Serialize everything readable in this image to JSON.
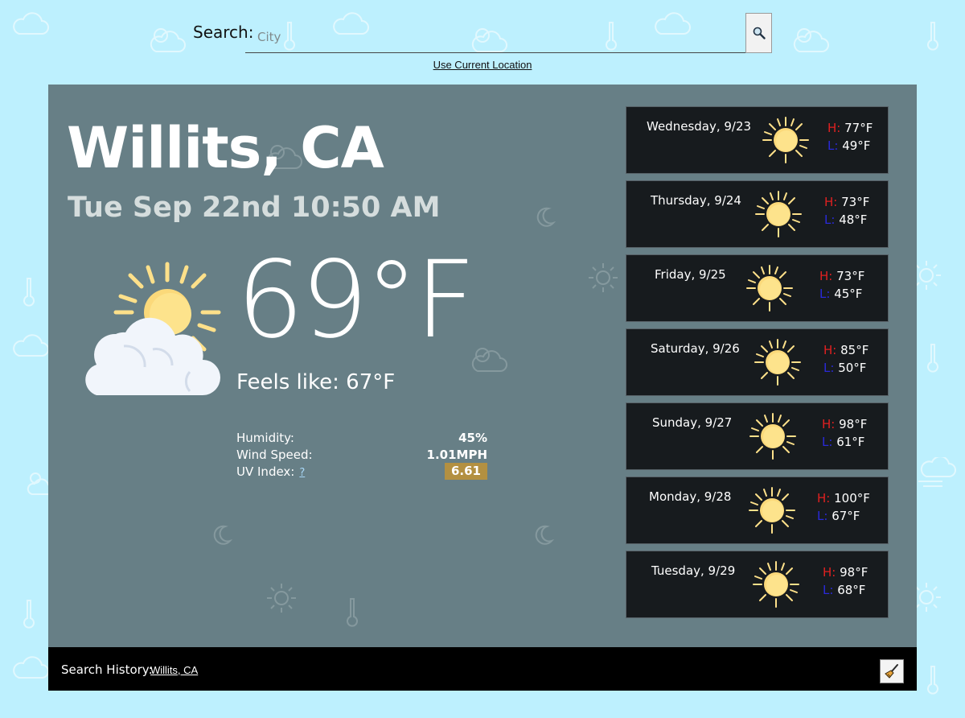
{
  "search": {
    "label": "Search:",
    "placeholder": "City",
    "button_icon": "magnifier-icon",
    "use_location": "Use Current Location"
  },
  "current": {
    "city": "Willits, CA",
    "datetime": "Tue Sep 22nd 10:50 AM",
    "icon": "sun-behind-cloud-icon",
    "temperature": "69°F",
    "feels_like": "Feels like: 67°F",
    "stats": {
      "humidity_label": "Humidity:",
      "humidity_value": "45%",
      "wind_label": "Wind Speed:",
      "wind_value": "1.01MPH",
      "uv_label": "UV Index:",
      "uv_help": "?",
      "uv_value": "6.61"
    }
  },
  "forecast": [
    {
      "day": "Wednesday, 9/23",
      "high_label": "H:",
      "high": "77°F",
      "low_label": "L:",
      "low": "49°F",
      "icon": "sun-icon"
    },
    {
      "day": "Thursday, 9/24",
      "high_label": "H:",
      "high": "73°F",
      "low_label": "L:",
      "low": "48°F",
      "icon": "sun-icon"
    },
    {
      "day": "Friday, 9/25",
      "high_label": "H:",
      "high": "73°F",
      "low_label": "L:",
      "low": "45°F",
      "icon": "sun-icon"
    },
    {
      "day": "Saturday, 9/26",
      "high_label": "H:",
      "high": "85°F",
      "low_label": "L:",
      "low": "50°F",
      "icon": "sun-icon"
    },
    {
      "day": "Sunday, 9/27",
      "high_label": "H:",
      "high": "98°F",
      "low_label": "L:",
      "low": "61°F",
      "icon": "sun-icon"
    },
    {
      "day": "Monday, 9/28",
      "high_label": "H:",
      "high": "100°F",
      "low_label": "L:",
      "low": "67°F",
      "icon": "sun-icon"
    },
    {
      "day": "Tuesday, 9/29",
      "high_label": "H:",
      "high": "98°F",
      "low_label": "L:",
      "low": "68°F",
      "icon": "sun-icon"
    }
  ],
  "history": {
    "label": "Search History:",
    "items": [
      "Willits, CA"
    ],
    "clear_icon": "broom-icon"
  },
  "colors": {
    "page_background": "#bdf0fe",
    "panel_background": "#677f86",
    "card_background": "#171b1e",
    "uv_badge": "#b39041",
    "high_label": "#e02020",
    "low_label": "#2a2ad8"
  }
}
